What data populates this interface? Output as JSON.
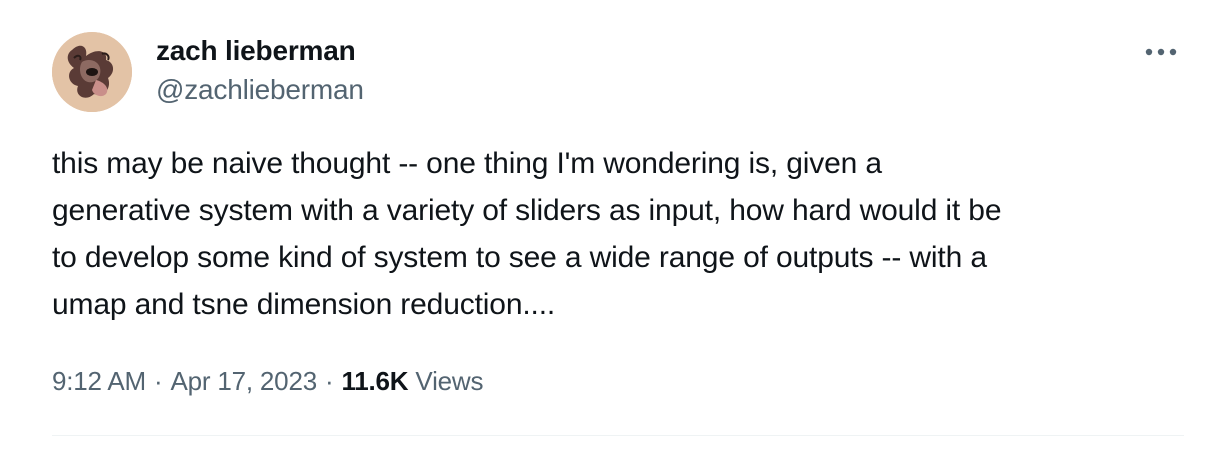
{
  "author": {
    "display_name": "zach lieberman",
    "handle": "@zachlieberman",
    "avatar_icon": "avatar-image"
  },
  "tweet": {
    "text_lines": [
      "this may be naive thought -- one thing I'm wondering is, given a",
      "generative system with a variety of sliders as input, how hard would it be",
      "to develop some kind of system to see a wide range of outputs -- with a",
      "umap and tsne dimension reduction...."
    ],
    "time": "9:12 AM",
    "date": "Apr 17, 2023",
    "separator": "·",
    "views_count": "11.6K",
    "views_label": "Views"
  },
  "more_icon": "more-horizontal-icon",
  "colors": {
    "text_primary": "#0f1419",
    "text_secondary": "#536471",
    "divider": "#eff3f4"
  }
}
